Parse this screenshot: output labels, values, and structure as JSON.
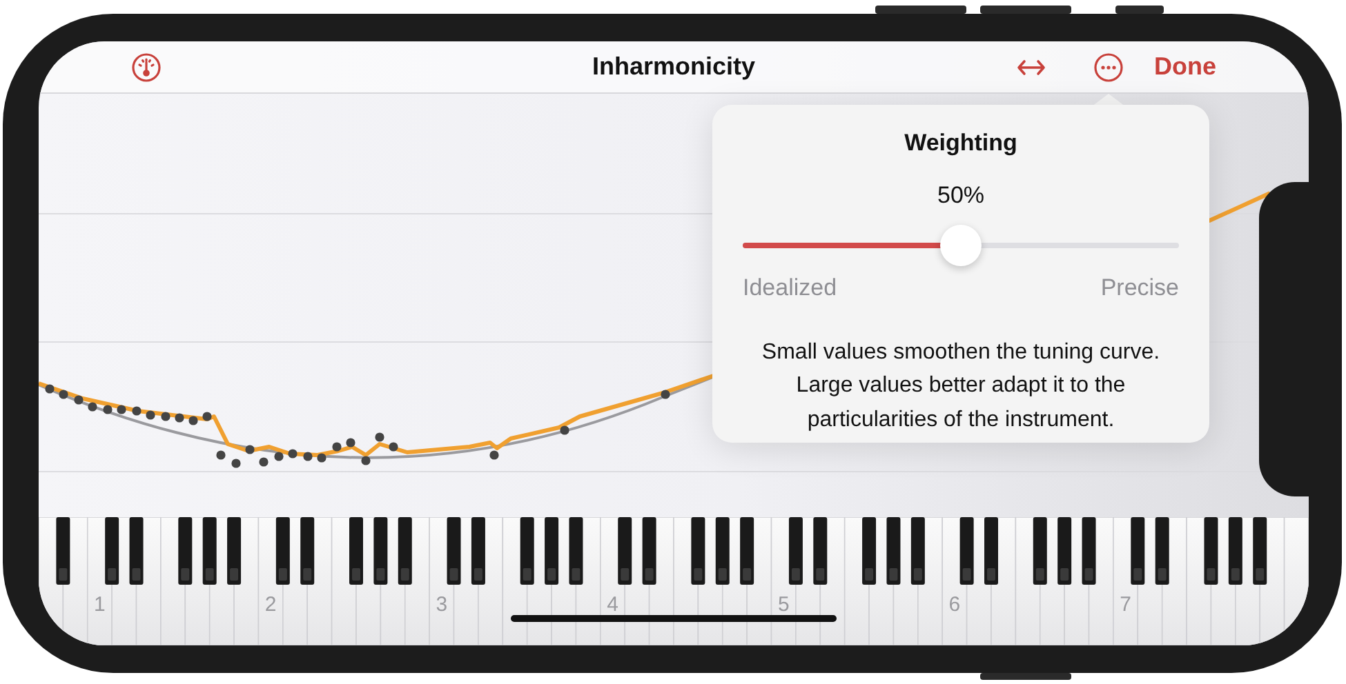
{
  "nav_bar": {
    "title": "Inharmonicity",
    "done_button": "Done"
  },
  "popover": {
    "title": "Weighting",
    "value": "50%",
    "slider": {
      "level": 0.5
    },
    "min_label": "Idealized",
    "max_label": "Precise",
    "description": "Small values smoothen the tuning curve. Large values better adapt it to the particularities of the instrument."
  },
  "keyboard": {
    "octave_labels": [
      "1",
      "2",
      "3",
      "4",
      "5",
      "6",
      "7"
    ]
  }
}
